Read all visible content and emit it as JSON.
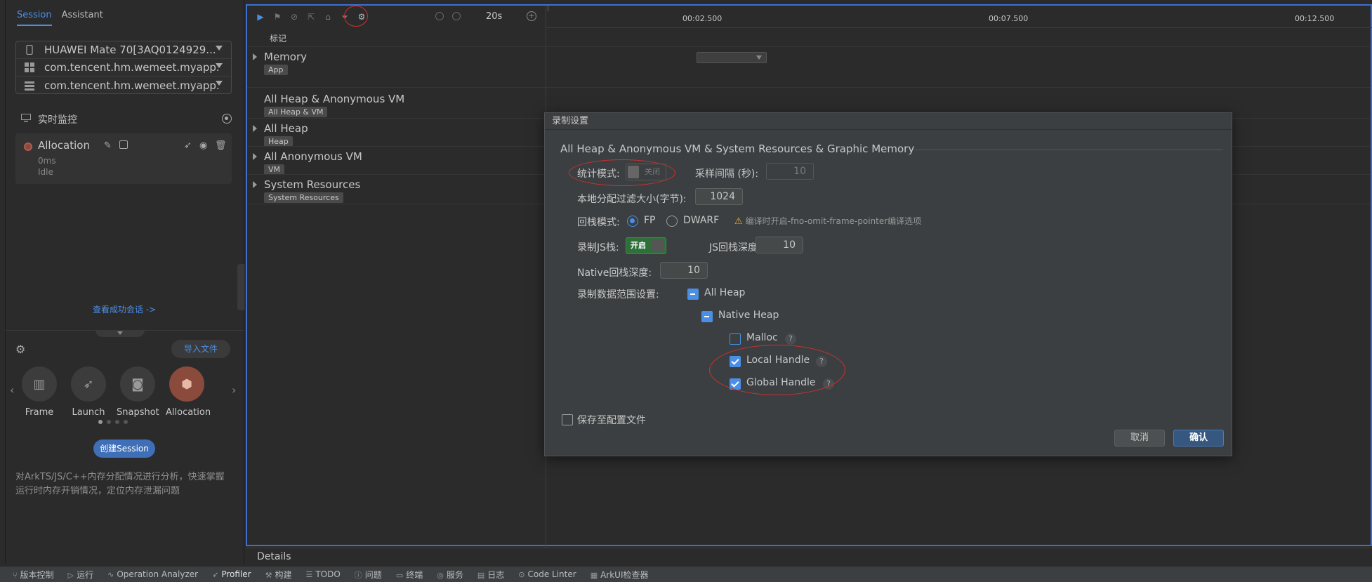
{
  "left_panel": {
    "tabs": [
      {
        "label": "Session",
        "active": true
      },
      {
        "label": "Assistant",
        "active": false
      }
    ],
    "devices": [
      {
        "label": "HUAWEI Mate 70[3AQ0124929...",
        "icon": "phone-icon"
      },
      {
        "label": "com.tencent.hm.wemeet.myapp...",
        "icon": "app-grid-icon"
      },
      {
        "label": "com.tencent.hm.wemeet.myapp...",
        "icon": "process-list-icon"
      }
    ],
    "monitor_label": "实时监控",
    "allocation_card": {
      "name": "Allocation",
      "time": "0ms",
      "state": "Idle"
    },
    "view_link": "查看成功会话 ->",
    "import_button": "导入文件",
    "modes": [
      {
        "label": "Frame",
        "icon": "frame-icon",
        "active": false
      },
      {
        "label": "Launch",
        "icon": "rocket-icon",
        "active": false
      },
      {
        "label": "Snapshot",
        "icon": "camera-icon",
        "active": false
      },
      {
        "label": "Allocation",
        "icon": "cube-icon",
        "active": true
      }
    ],
    "create_button": "创建Session",
    "description": "对ArkTS/JS/C++内存分配情况进行分析，快速掌握运行时内存开销情况，定位内存泄漏问题"
  },
  "toolbar": {
    "zoom": "20s"
  },
  "timeline": {
    "ticks": [
      "00:02.500",
      "00:07.500",
      "00:12.500"
    ],
    "mark_label": "标记"
  },
  "lanes": [
    {
      "title": "Memory",
      "tag": "App",
      "expandable": true
    },
    {
      "title": "All Heap & Anonymous VM",
      "tag": "All Heap & VM",
      "expandable": false
    },
    {
      "title": "All Heap",
      "tag": "Heap",
      "expandable": true
    },
    {
      "title": "All Anonymous VM",
      "tag": "VM",
      "expandable": true
    },
    {
      "title": "System Resources",
      "tag": "System Resources",
      "expandable": true
    }
  ],
  "dialog": {
    "title": "录制设置",
    "section": "All Heap & Anonymous VM & System Resources & Graphic Memory",
    "stat_mode_label": "统计模式:",
    "stat_mode_value": "关闭",
    "sample_interval_label": "采样间隔 (秒):",
    "sample_interval_value": "10",
    "filter_size_label": "本地分配过滤大小(字节):",
    "filter_size_value": "1024",
    "stack_mode_label": "回栈模式:",
    "stack_mode_options": [
      "FP",
      "DWARF"
    ],
    "stack_mode_selected": "FP",
    "stack_warning": "编译时开启-fno-omit-frame-pointer编译选项",
    "js_stack_label": "录制JS栈:",
    "js_stack_value": "开启",
    "js_depth_label": "JS回栈深度:",
    "js_depth_value": "10",
    "native_depth_label": "Native回栈深度:",
    "native_depth_value": "10",
    "range_label": "录制数据范围设置:",
    "range_items": [
      {
        "label": "All Heap",
        "state": "partial",
        "help": false
      },
      {
        "label": "Native Heap",
        "state": "partial",
        "help": false
      },
      {
        "label": "Malloc",
        "state": "unchecked",
        "help": true
      },
      {
        "label": "Local Handle",
        "state": "checked",
        "help": true
      },
      {
        "label": "Global Handle",
        "state": "checked",
        "help": true
      }
    ],
    "save_config_label": "保存至配置文件",
    "cancel_label": "取消",
    "ok_label": "确认"
  },
  "details_label": "Details",
  "statusbar": [
    {
      "label": "版本控制",
      "icon": "branch-icon"
    },
    {
      "label": "运行",
      "icon": "run-icon"
    },
    {
      "label": "Operation Analyzer",
      "icon": "chart-icon"
    },
    {
      "label": "Profiler",
      "icon": "profiler-icon",
      "active": true
    },
    {
      "label": "构建",
      "icon": "hammer-icon"
    },
    {
      "label": "TODO",
      "icon": "list-icon"
    },
    {
      "label": "问题",
      "icon": "info-icon"
    },
    {
      "label": "终端",
      "icon": "terminal-icon"
    },
    {
      "label": "服务",
      "icon": "services-icon"
    },
    {
      "label": "日志",
      "icon": "log-icon"
    },
    {
      "label": "Code Linter",
      "icon": "linter-icon"
    },
    {
      "label": "ArkUI检查器",
      "icon": "inspector-icon"
    }
  ]
}
